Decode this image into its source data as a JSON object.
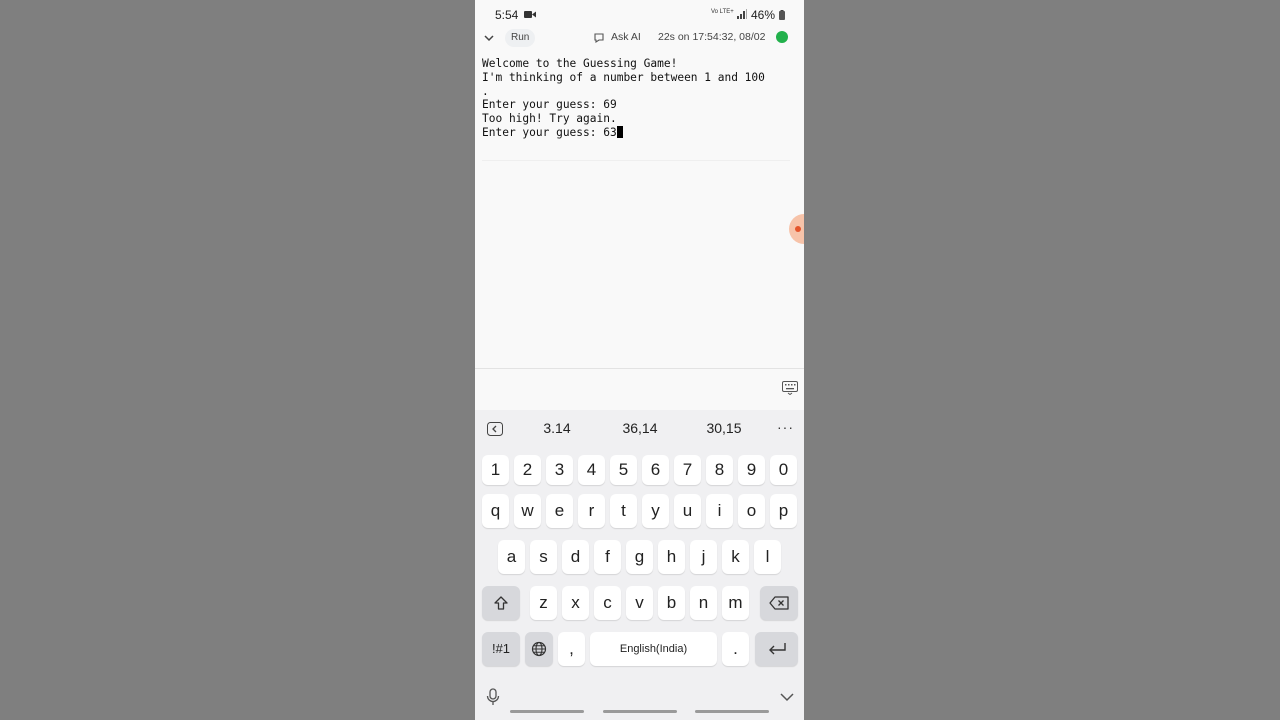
{
  "status_bar": {
    "time": "5:54",
    "network": "Vo LTE+",
    "battery": "46%"
  },
  "toolbar": {
    "run_label": "Run",
    "ask_label": "Ask AI",
    "run_info": "22s on 17:54:32, 08/02",
    "status_color": "#22b14c"
  },
  "console": {
    "lines": [
      "Welcome to the Guessing Game!",
      "I'm thinking of a number between 1 and 100",
      ".",
      "Enter your guess: 69",
      "Too high! Try again.",
      "Enter your guess: 63"
    ]
  },
  "keyboard": {
    "suggestions": [
      "3.14",
      "36,14",
      "30,15"
    ],
    "more_label": "···",
    "row_numbers": [
      "1",
      "2",
      "3",
      "4",
      "5",
      "6",
      "7",
      "8",
      "9",
      "0"
    ],
    "row1": [
      "q",
      "w",
      "e",
      "r",
      "t",
      "y",
      "u",
      "i",
      "o",
      "p"
    ],
    "row2": [
      "a",
      "s",
      "d",
      "f",
      "g",
      "h",
      "j",
      "k",
      "l"
    ],
    "row3": [
      "z",
      "x",
      "c",
      "v",
      "b",
      "n",
      "m"
    ],
    "symbols_label": "!#1",
    "comma": ",",
    "space_label": "English(India)",
    "period": ".",
    "icons": [
      "shift-icon",
      "backspace-icon",
      "globe-icon",
      "enter-icon",
      "mic-icon",
      "hide-keyboard-icon"
    ]
  }
}
